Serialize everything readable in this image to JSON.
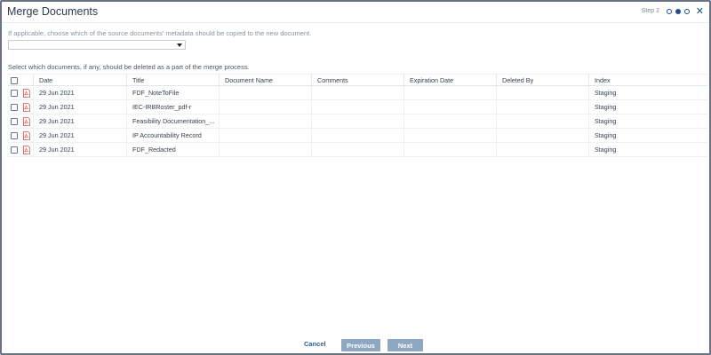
{
  "dialog": {
    "title": "Merge Documents",
    "step_label": "Step 2",
    "steps_total": 3,
    "current_step": 2
  },
  "metadata": {
    "instruction": "If applicable, choose which of the source documents' metadata should be copied to the new document.",
    "selected_value": ""
  },
  "delete": {
    "instruction": "Select which documents, if any, should be deleted as a part of the merge process."
  },
  "table": {
    "columns": {
      "date": "Date",
      "title": "Title",
      "document_name": "Document Name",
      "comments": "Comments",
      "expiration_date": "Expiration Date",
      "deleted_by": "Deleted By",
      "index": "Index"
    },
    "rows": [
      {
        "date": "29 Jun 2021",
        "title": "FDF_NoteToFile",
        "document_name": "",
        "comments": "",
        "expiration_date": "",
        "deleted_by": "",
        "index": "Staging",
        "checked": false,
        "icon": "pdf-icon"
      },
      {
        "date": "29 Jun 2021",
        "title": "IEC-IRBRoster_pdf-r",
        "document_name": "",
        "comments": "",
        "expiration_date": "",
        "deleted_by": "",
        "index": "Staging",
        "checked": false,
        "icon": "pdf-icon"
      },
      {
        "date": "29 Jun 2021",
        "title": "Feasibility Documentation_...",
        "document_name": "",
        "comments": "",
        "expiration_date": "",
        "deleted_by": "",
        "index": "Staging",
        "checked": false,
        "icon": "pdf-icon"
      },
      {
        "date": "29 Jun 2021",
        "title": "IP Accountability Record",
        "document_name": "",
        "comments": "",
        "expiration_date": "",
        "deleted_by": "",
        "index": "Staging",
        "checked": false,
        "icon": "pdf-icon"
      },
      {
        "date": "29 Jun 2021",
        "title": "FDF_Redacted",
        "document_name": "",
        "comments": "",
        "expiration_date": "",
        "deleted_by": "",
        "index": "Staging",
        "checked": false,
        "icon": "pdf-icon"
      }
    ]
  },
  "footer": {
    "cancel_label": "Cancel",
    "previous_label": "Previous",
    "next_label": "Next"
  },
  "colors": {
    "accent": "#1e4e8c",
    "button_disabled": "#8ea7c2",
    "pdf_icon": "#d9534f"
  }
}
